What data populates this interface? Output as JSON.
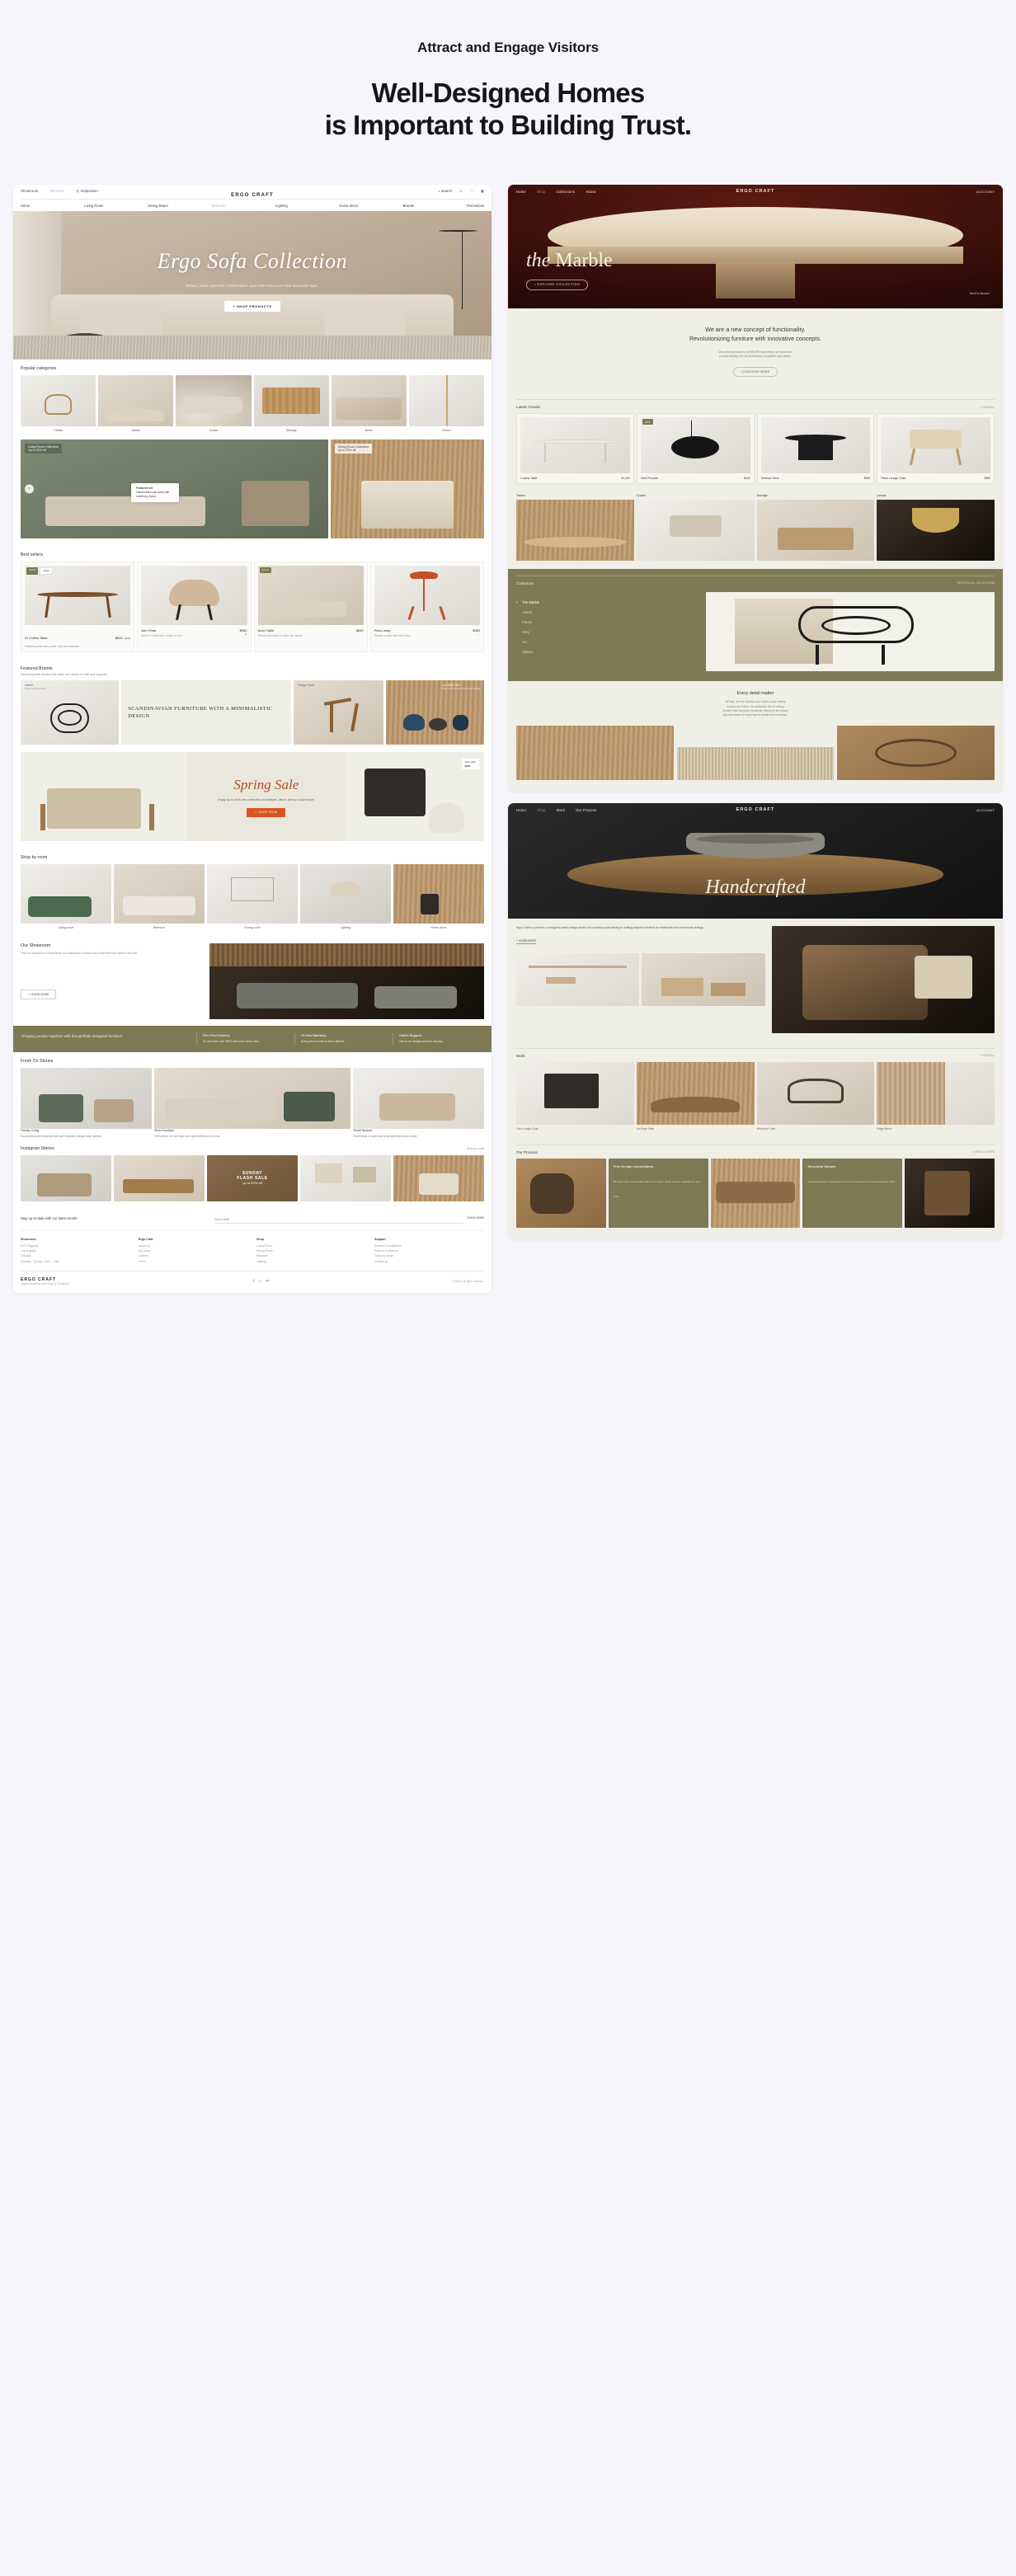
{
  "page": {
    "eyebrow": "Attract and Engage Visitors",
    "headline_line1": "Well-Designed Homes",
    "headline_line2": "is Important to Building Trust."
  },
  "brand": "ERGO CRAFT",
  "mock1": {
    "nav_top": [
      {
        "label": "Showroom",
        "muted": false
      },
      {
        "label": "Services",
        "muted": true
      },
      {
        "label": "Inspiration",
        "muted": false
      }
    ],
    "nav_icons": {
      "search": "Search",
      "account": "account-icon",
      "wishlist": "wishlist-icon",
      "bag": "bag-icon"
    },
    "nav_main": [
      {
        "label": "Home",
        "muted": false
      },
      {
        "label": "Living Room",
        "muted": false
      },
      {
        "label": "Dining Room",
        "muted": false
      },
      {
        "label": "Bedroom",
        "muted": true
      },
      {
        "label": "Lighting",
        "muted": false
      },
      {
        "label": "Home decor",
        "muted": false
      },
      {
        "label": "Brands",
        "muted": false
      },
      {
        "label": "Promotions",
        "muted": false
      }
    ],
    "hero": {
      "title": "Ergo Sofa Collection",
      "subtitle": "Relax, make yourself comfortable, and sink into your new favourite spot.",
      "cta": "+ SHOP PRODUCTS"
    },
    "categories": {
      "title": "Popular categories",
      "items": [
        {
          "name": "Chairs"
        },
        {
          "name": "Tables"
        },
        {
          "name": "Sofas"
        },
        {
          "name": "Storage"
        },
        {
          "name": "Beds"
        },
        {
          "name": "Decor"
        }
      ]
    },
    "promo": {
      "left_badge": "Living Room Collection",
      "left_sub": "Up to 40% off",
      "right_badge": "Dining Room Collection",
      "right_sub": "Up to 25% off",
      "card_title": "Featured set",
      "card_text": "Handcrafted oak table with matching chairs"
    },
    "bestsellers": {
      "title": "Best sellers",
      "badges": [
        "SALE",
        "NEW"
      ],
      "items": [
        {
          "name": "IO Coffee Table",
          "desc": "Featuring solid brass, steel, and nice travertine",
          "price": "$800",
          "old": "$980"
        },
        {
          "name": "Arm Chair",
          "desc": "Solid in construction, simple in form",
          "price": "$960",
          "old": ""
        },
        {
          "name": "Noxx Table",
          "desc": "Minimal silhouette in warm oak veneer",
          "price": "$640",
          "old": ""
        },
        {
          "name": "Flow Lamp",
          "desc": "Powder-coated steel floor lamp",
          "price": "$380",
          "old": ""
        }
      ]
    },
    "featured": {
      "title": "Featured Brands",
      "subtitle": "Partnering with studios that share our values of craft and longevity",
      "tile1_label": "Kartell",
      "tile1_sub": "Modern dining chairs",
      "center_text": "SCANDINAVIAN FURNITURE WITH A MINIMALISTIC DESIGN",
      "tile2_label": "Design Team",
      "tile3_label": "LA HOME DEC",
      "tile3_sub": "Home accessories with Nordic design"
    },
    "sale": {
      "title": "Spring Sale",
      "text": "Enjoy up to 40% off a selection of furniture, decor, and so much more.",
      "cta": "+ SHOP NOW",
      "chip_label": "Side table",
      "chip_price": "$280"
    },
    "rooms": {
      "title": "Shop by room",
      "items": [
        {
          "name": "Living room"
        },
        {
          "name": "Bedroom"
        },
        {
          "name": "Dining room"
        },
        {
          "name": "Lighting"
        },
        {
          "name": "Home decor"
        }
      ]
    },
    "showroom": {
      "title": "Our Showroom",
      "text": "Visit our showroom to experience our collections in person and meet the team behind the craft.",
      "cta": "+ LEARN MORE"
    },
    "band": {
      "headline": "Bringing people together with thoughtfully designed furniture",
      "items": [
        {
          "title": "Free First Delivery",
          "text": "On all orders over $500 within the metro area"
        },
        {
          "title": "10-Year Warranty",
          "text": "Every piece is built to last a lifetime"
        },
        {
          "title": "Online Support",
          "text": "Talk to our design advisors any day"
        }
      ]
    },
    "stories": {
      "title": "Fresh On Stories",
      "items": [
        {
          "name": "Family Living",
          "caption": "How pairing warm materials with open formats changes daily routines"
        },
        {
          "name": "Slow Sundays",
          "caption": "The comfort of a soft sofa and a quiet afternoon at home"
        },
        {
          "name": "Small Spaces",
          "caption": "Smart ideas to make your small apartment work harder"
        }
      ]
    },
    "instagram": {
      "title": "Instagram Stories",
      "handle": "@ergo.craft",
      "overlay_line1": "SUNDAY",
      "overlay_line2": "FLASH SALE",
      "overlay_line3": "up to 50% off"
    },
    "footer": {
      "newsletter_title": "Stay up-to-date with our latest trends",
      "email_placeholder": "Your e-mail",
      "submit": "SUBSCRIBE",
      "columns": [
        {
          "title": "Showroom",
          "links": [
            "NYC Flagship",
            "Los Angeles",
            "Chicago",
            "Monday - Sunday, 10am - 7pm"
          ]
        },
        {
          "title": "Ergo Craft",
          "links": [
            "About us",
            "Our story",
            "Careers",
            "Press"
          ]
        },
        {
          "title": "Shop",
          "links": [
            "Living Room",
            "Dining Room",
            "Bedroom",
            "Lighting"
          ]
        },
        {
          "title": "Support",
          "links": [
            "Delivery & Installation",
            "Returns & Refunds",
            "Track my Order",
            "Contact us"
          ]
        }
      ],
      "brand": "ERGO CRAFT",
      "legal": "Legal information and Terms & Conditions",
      "copyright": "© 2024. All rights reserved.",
      "social": [
        "facebook-icon",
        "instagram-icon",
        "pinterest-icon"
      ]
    }
  },
  "mock2": {
    "nav": [
      {
        "label": "Home",
        "muted": false
      },
      {
        "label": "Shop",
        "muted": true
      },
      {
        "label": "Collections",
        "muted": false
      },
      {
        "label": "About",
        "muted": false
      }
    ],
    "nav_right": "ACCOUNT",
    "hero": {
      "pre": "the",
      "title": "Marble",
      "cta": "• EXPLORE COLLECTION",
      "corner": "Scroll to discover"
    },
    "intro": {
      "line1": "We are a new concept of functionality.",
      "line2": "Revolutionizing furniture with innovative concepts.",
      "body_line1": "Discover the essence of ERGO® experience: an immersive",
      "body_line2": "journey delving into our philosophy, principles, and values.",
      "cta": "• DISCOVER MORE"
    },
    "arrivals": {
      "title": "Latest Arrivals",
      "more": "+ VIEW ALL",
      "badge": "NEW",
      "items": [
        {
          "name": "Lunaria Table",
          "price": "$1,250"
        },
        {
          "name": "Orbit Pendant",
          "price": "$430"
        },
        {
          "name": "Tambour Stool",
          "price": "$390"
        },
        {
          "name": "Paulo Lounge Chair",
          "price": "$980"
        }
      ]
    },
    "quads": {
      "items": [
        {
          "title": "Tables"
        },
        {
          "title": "Chairs"
        },
        {
          "title": "Storage"
        },
        {
          "title": "Lamps"
        }
      ]
    },
    "collections": {
      "title": "Collections",
      "more": "+ BROWSE ALL COLLECTIONS",
      "items": [
        "The Marble",
        "Calero",
        "Parole",
        "Veny",
        "Arc",
        "Salaya"
      ]
    },
    "detail": {
      "title": "Every detail matter",
      "text_line1": "At Ergo, we find solutions and values simple lasting",
      "text_line2": "tectonic and vision. Our dedication lies in crafting",
      "text_line3": "furniture that surpasses functional, imbued in the beauty",
      "text_line4": "and importance of honouring the details and innovation."
    }
  },
  "mock3": {
    "nav": [
      {
        "label": "Home",
        "muted": false
      },
      {
        "label": "Shop",
        "muted": true
      },
      {
        "label": "Work",
        "muted": false
      },
      {
        "label": "Our Process",
        "muted": false
      }
    ],
    "nav_right": "ACCOUNT",
    "hero": {
      "title": "Handcrafted"
    },
    "about": {
      "text": "Ergo Craft is a premier Los Angeles-based design studio and workshop specializing in crafting bespoke furniture for residential and commercial settings.",
      "cta": "+ LEARN MORE"
    },
    "work": {
      "title": "Work",
      "more": "+ VIEW ALL",
      "items": [
        {
          "name": "Oslo Lounge Chair"
        },
        {
          "name": "Arc Edge Table"
        },
        {
          "name": "Wishbone Chair"
        },
        {
          "name": "Ridge Bench"
        }
      ]
    },
    "process": {
      "title": "Our Process",
      "more": "+ SEE ALL STEPS",
      "cards": [
        {
          "title": "Free Design Consultation",
          "text": "We begin with a conversation about your space, needs, and the materials you love most."
        },
        {
          "title": "Structural Sample",
          "text": "A scaled prototype is produced so every joint and curve can be tested before build."
        }
      ]
    }
  }
}
